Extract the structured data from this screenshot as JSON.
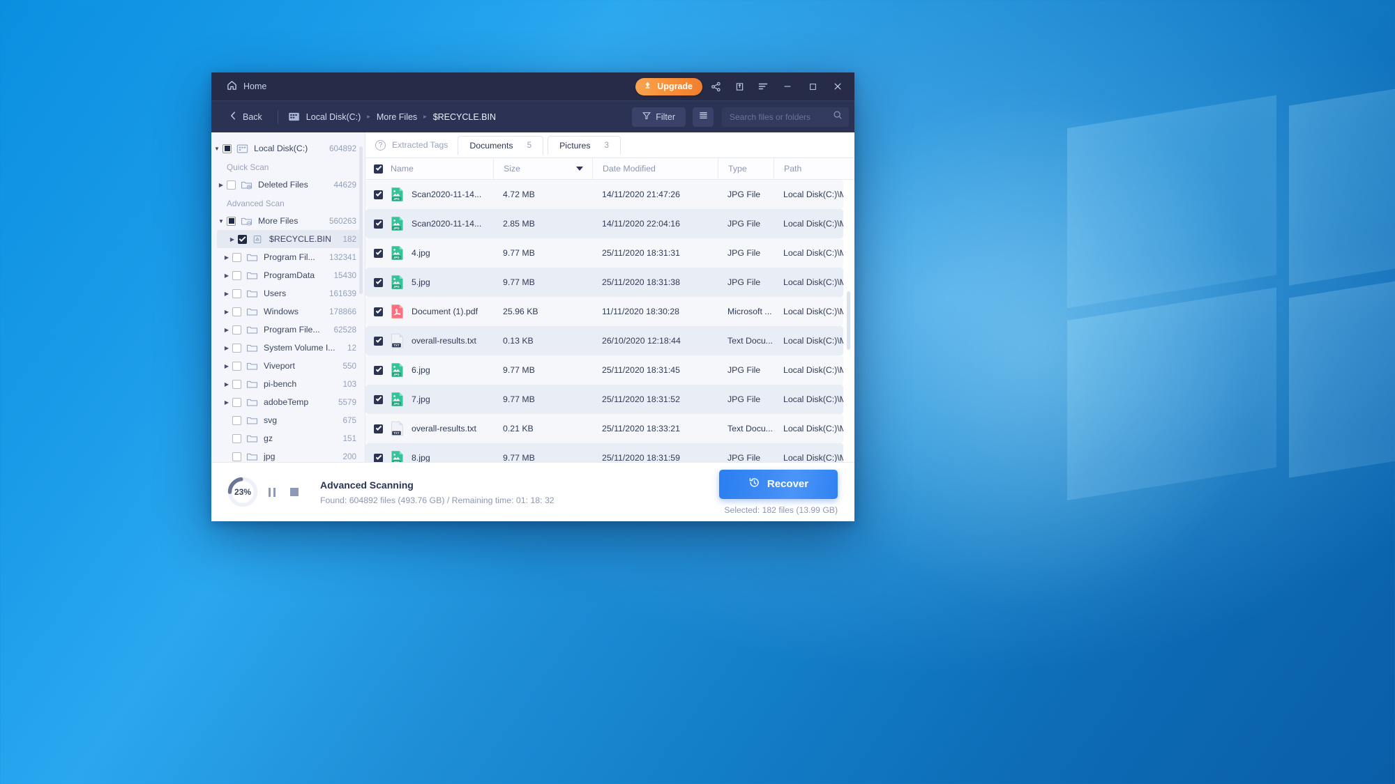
{
  "titlebar": {
    "home_label": "Home",
    "upgrade_label": "Upgrade",
    "icons": [
      "share-icon",
      "export-icon",
      "menu-icon",
      "minimize-icon",
      "maximize-icon",
      "close-icon"
    ]
  },
  "breadcrumb": {
    "back_label": "Back",
    "drive_icon": "disk-icon",
    "crumbs": [
      "Local Disk(C:)",
      "More Files",
      "$RECYCLE.BIN"
    ],
    "separator": "▸",
    "filter_label": "Filter",
    "search_placeholder": "Search files or folders"
  },
  "sidebar": {
    "root": {
      "label": "Local Disk(C:)",
      "count": "604892",
      "icon": "disk-icon",
      "checkbox": "partial",
      "expanded": true
    },
    "sections": [
      {
        "label": "Quick Scan",
        "items": [
          {
            "label": "Deleted Files",
            "count": "44629",
            "icon": "deleted-folder-icon",
            "checkbox": "unchecked",
            "arrow": true
          }
        ]
      },
      {
        "label": "Advanced Scan",
        "items": [
          {
            "label": "More Files",
            "count": "560263",
            "icon": "more-folder-icon",
            "checkbox": "partial",
            "arrow": true,
            "expanded": true
          },
          {
            "label": "$RECYCLE.BIN",
            "count": "182",
            "icon": "recycle-bin-icon",
            "checkbox": "checked",
            "arrow": true,
            "selected": true,
            "indent": 2
          },
          {
            "label": "Program Fil...",
            "count": "132341",
            "icon": "folder-icon",
            "checkbox": "unchecked",
            "arrow": true,
            "indent": 2
          },
          {
            "label": "ProgramData",
            "count": "15430",
            "icon": "folder-icon",
            "checkbox": "unchecked",
            "arrow": true,
            "indent": 2
          },
          {
            "label": "Users",
            "count": "161639",
            "icon": "folder-icon",
            "checkbox": "unchecked",
            "arrow": true,
            "indent": 2
          },
          {
            "label": "Windows",
            "count": "178866",
            "icon": "folder-icon",
            "checkbox": "unchecked",
            "arrow": true,
            "indent": 2
          },
          {
            "label": "Program File...",
            "count": "62528",
            "icon": "folder-icon",
            "checkbox": "unchecked",
            "arrow": true,
            "indent": 2
          },
          {
            "label": "System Volume I...",
            "count": "12",
            "icon": "folder-icon",
            "checkbox": "unchecked",
            "arrow": true,
            "indent": 2
          },
          {
            "label": "Viveport",
            "count": "550",
            "icon": "folder-icon",
            "checkbox": "unchecked",
            "arrow": true,
            "indent": 2
          },
          {
            "label": "pi-bench",
            "count": "103",
            "icon": "folder-icon",
            "checkbox": "unchecked",
            "arrow": true,
            "indent": 2
          },
          {
            "label": "adobeTemp",
            "count": "5579",
            "icon": "folder-icon",
            "checkbox": "unchecked",
            "arrow": true,
            "indent": 2
          },
          {
            "label": "svg",
            "count": "675",
            "icon": "folder-icon",
            "checkbox": "unchecked",
            "arrow": false,
            "indent": 2
          },
          {
            "label": "gz",
            "count": "151",
            "icon": "folder-icon",
            "checkbox": "unchecked",
            "arrow": false,
            "indent": 2
          },
          {
            "label": "jpg",
            "count": "200",
            "icon": "folder-icon",
            "checkbox": "unchecked",
            "arrow": false,
            "indent": 2
          }
        ]
      }
    ]
  },
  "tabs": {
    "extracted_label": "Extracted Tags",
    "help_icon": "question-icon",
    "items": [
      {
        "label": "Documents",
        "count": "5"
      },
      {
        "label": "Pictures",
        "count": "3"
      }
    ]
  },
  "table": {
    "select_all_checked": true,
    "columns": [
      "Name",
      "Size",
      "Date Modified",
      "Type",
      "Path"
    ],
    "sort_column": "Size",
    "sort_direction": "desc",
    "rows": [
      {
        "name": "8.jpg",
        "size": "9.77 MB",
        "date": "25/11/2020 18:31:59",
        "type": "JPG File",
        "path": "Local Disk(C:)\\More ...",
        "icon": "jpg-file-icon",
        "checked": true
      },
      {
        "name": "overall-results.txt",
        "size": "0.21 KB",
        "date": "25/11/2020 18:33:21",
        "type": "Text Docu...",
        "path": "Local Disk(C:)\\More ...",
        "icon": "txt-file-icon",
        "checked": true
      },
      {
        "name": "7.jpg",
        "size": "9.77 MB",
        "date": "25/11/2020 18:31:52",
        "type": "JPG File",
        "path": "Local Disk(C:)\\More ...",
        "icon": "jpg-file-icon",
        "checked": true
      },
      {
        "name": "6.jpg",
        "size": "9.77 MB",
        "date": "25/11/2020 18:31:45",
        "type": "JPG File",
        "path": "Local Disk(C:)\\More ...",
        "icon": "jpg-file-icon",
        "checked": true
      },
      {
        "name": "overall-results.txt",
        "size": "0.13 KB",
        "date": "26/10/2020 12:18:44",
        "type": "Text Docu...",
        "path": "Local Disk(C:)\\More ...",
        "icon": "txt-file-icon",
        "checked": true
      },
      {
        "name": "Document (1).pdf",
        "size": "25.96 KB",
        "date": "11/11/2020 18:30:28",
        "type": "Microsoft ...",
        "path": "Local Disk(C:)\\More ...",
        "icon": "pdf-file-icon",
        "checked": true
      },
      {
        "name": "5.jpg",
        "size": "9.77 MB",
        "date": "25/11/2020 18:31:38",
        "type": "JPG File",
        "path": "Local Disk(C:)\\More ...",
        "icon": "jpg-file-icon",
        "checked": true
      },
      {
        "name": "4.jpg",
        "size": "9.77 MB",
        "date": "25/11/2020 18:31:31",
        "type": "JPG File",
        "path": "Local Disk(C:)\\More ...",
        "icon": "jpg-file-icon",
        "checked": true
      },
      {
        "name": "Scan2020-11-14...",
        "size": "2.85 MB",
        "date": "14/11/2020 22:04:16",
        "type": "JPG File",
        "path": "Local Disk(C:)\\More ...",
        "icon": "jpg-file-icon",
        "checked": true
      },
      {
        "name": "Scan2020-11-14...",
        "size": "4.72 MB",
        "date": "14/11/2020 21:47:26",
        "type": "JPG File",
        "path": "Local Disk(C:)\\More ...",
        "icon": "jpg-file-icon",
        "checked": true
      }
    ]
  },
  "footer": {
    "progress_percent": "23%",
    "progress_value": 23,
    "status_title": "Advanced Scanning",
    "status_sub": "Found: 604892 files (493.76 GB) / Remaining time: 01: 18: 32",
    "pause_icon": "pause-icon",
    "stop_icon": "stop-icon",
    "recover_label": "Recover",
    "recover_icon": "restore-clock-icon",
    "selected_text": "Selected: 182 files (13.99 GB)"
  },
  "colors": {
    "titlebar": "#262c47",
    "crumbbar": "#2b3253",
    "upgrade": "#f7923a",
    "recover": "#3f8bf5",
    "checkbox": "#2b3453",
    "jpg": "#2fbf91",
    "pdf": "#f4646d",
    "txt": "#2b3453"
  }
}
